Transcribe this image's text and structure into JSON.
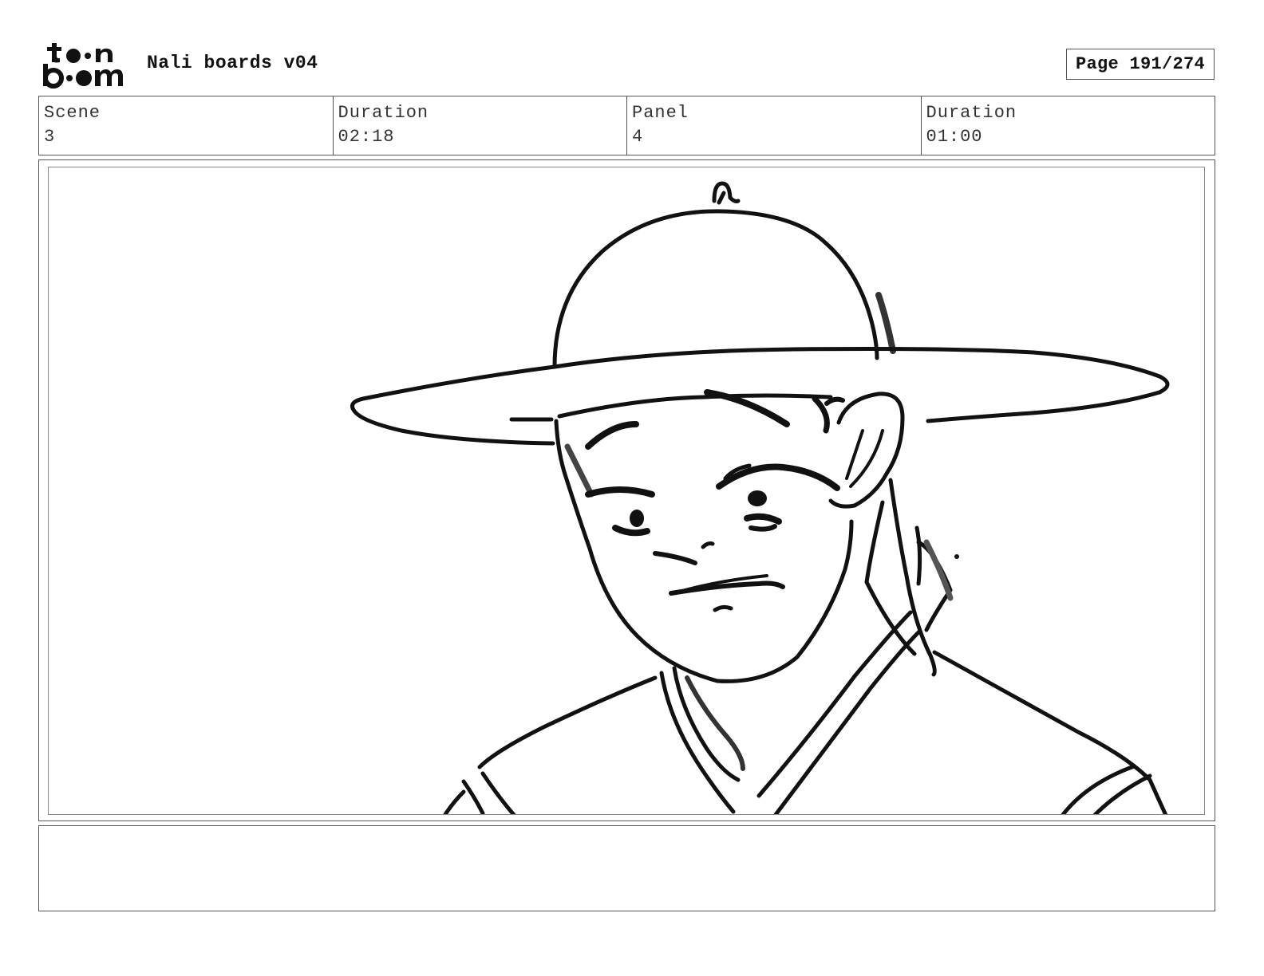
{
  "header": {
    "title": "Nali boards v04",
    "page_label": "Page 191/274"
  },
  "logo": {
    "icon": "toon-boom-logo-icon",
    "line1": "to•n",
    "line2": "b••m"
  },
  "info": {
    "scene_label": "Scene",
    "scene_value": "3",
    "scene_duration_label": "Duration",
    "scene_duration_value": "02:18",
    "panel_label": "Panel",
    "panel_value": "4",
    "panel_duration_label": "Duration",
    "panel_duration_value": "01:00"
  },
  "panel": {
    "image_icon": "storyboard-sketch-icon"
  },
  "notes": {
    "text": ""
  }
}
